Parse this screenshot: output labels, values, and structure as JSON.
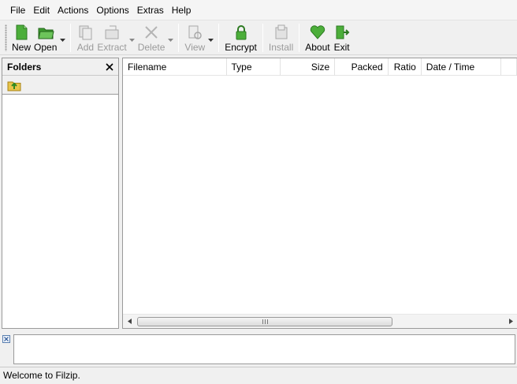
{
  "menu": [
    "File",
    "Edit",
    "Actions",
    "Options",
    "Extras",
    "Help"
  ],
  "toolbar": {
    "new": "New",
    "open": "Open",
    "add": "Add",
    "extract": "Extract",
    "delete": "Delete",
    "view": "View",
    "encrypt": "Encrypt",
    "install": "Install",
    "about": "About",
    "exit": "Exit"
  },
  "folders": {
    "title": "Folders"
  },
  "columns": [
    "Filename",
    "Type",
    "Size",
    "Packed",
    "Ratio",
    "Date / Time"
  ],
  "status": {
    "text": "Welcome to Filzip."
  },
  "colors": {
    "accent": "#3a8a2c",
    "border": "#9a9a9a",
    "disabled": "#9a9a9a"
  }
}
